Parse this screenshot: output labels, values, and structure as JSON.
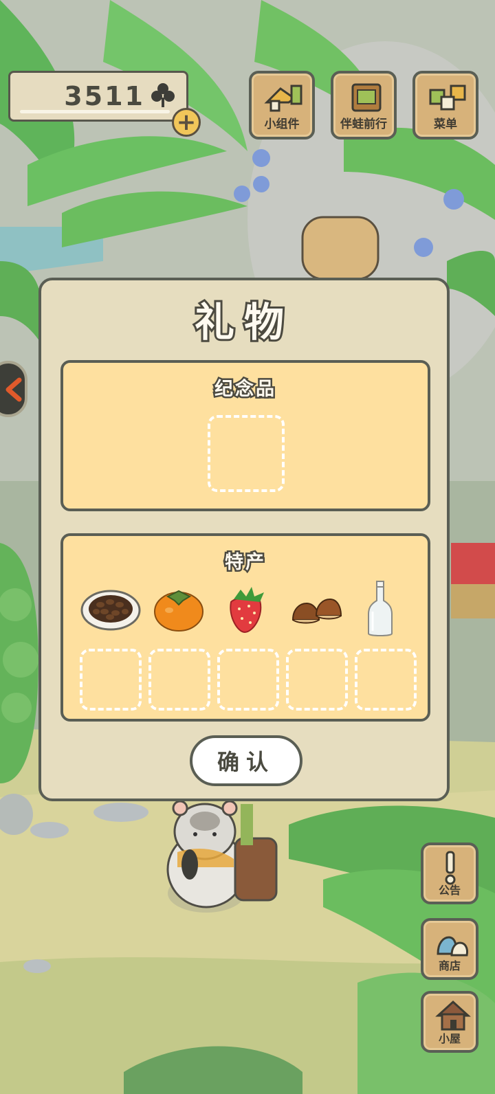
{
  "currency": {
    "amount": "3511",
    "icon": "clover-icon",
    "add_icon": "plus-icon"
  },
  "top_buttons": [
    {
      "label": "小组件",
      "icon": "widget-icon"
    },
    {
      "label": "伴蛙前行",
      "icon": "journey-album-icon"
    },
    {
      "label": "菜单",
      "icon": "menu-cards-icon"
    }
  ],
  "side_buttons": [
    {
      "label": "公告",
      "icon": "exclamation-icon"
    },
    {
      "label": "商店",
      "icon": "shop-bags-icon"
    },
    {
      "label": "小屋",
      "icon": "house-icon"
    }
  ],
  "dialog": {
    "title": "礼物",
    "souvenir": {
      "title": "纪念品",
      "slot_count": 1
    },
    "specialty": {
      "title": "特产",
      "items": [
        {
          "name": "coffee-beans",
          "icon": "coffee-beans-icon"
        },
        {
          "name": "persimmon",
          "icon": "persimmon-icon"
        },
        {
          "name": "strawberry",
          "icon": "strawberry-icon"
        },
        {
          "name": "chestnuts",
          "icon": "chestnuts-icon"
        },
        {
          "name": "glass-bottle",
          "icon": "bottle-icon"
        }
      ],
      "slot_count": 5
    },
    "confirm_label": "确认"
  },
  "colors": {
    "panel": "#fee09f",
    "dialog": "#e6ddbf",
    "outline": "#5a5e54",
    "button_wood": "#d7b27a"
  }
}
